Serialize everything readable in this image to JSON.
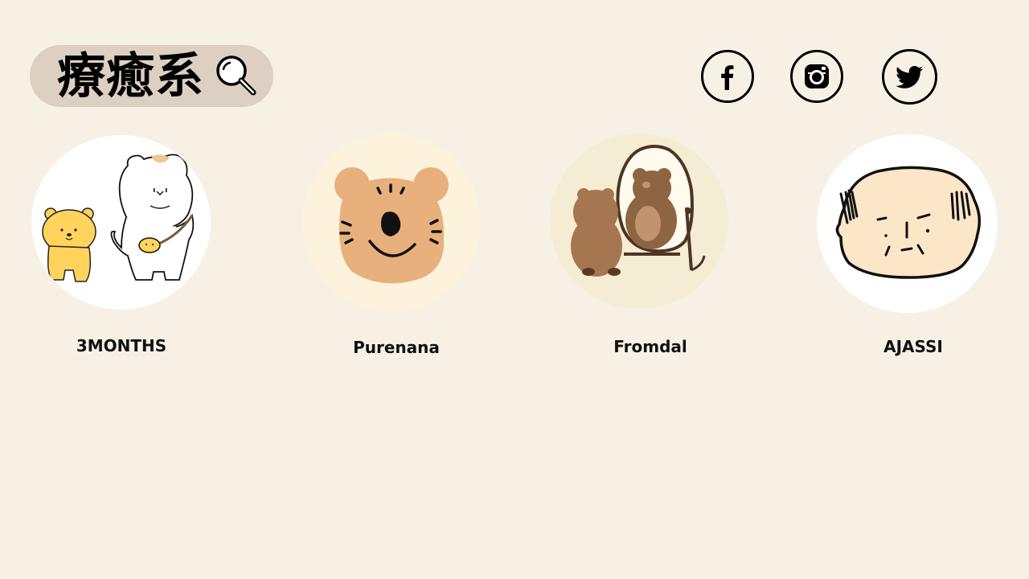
{
  "header": {
    "title": "療癒系",
    "search_icon": "search-icon"
  },
  "social": [
    {
      "name": "facebook",
      "icon": "facebook-icon"
    },
    {
      "name": "instagram",
      "icon": "instagram-icon"
    },
    {
      "name": "twitter",
      "icon": "twitter-icon"
    }
  ],
  "characters": [
    {
      "label": "3MONTHS",
      "avatar": "two-white-and-yellow-bears-avatar"
    },
    {
      "label": "Purenana",
      "avatar": "tiger-face-avatar"
    },
    {
      "label": "Fromdal",
      "avatar": "bear-mirror-avatar"
    },
    {
      "label": "AJASSI",
      "avatar": "bald-man-face-avatar"
    }
  ],
  "colors": {
    "background": "#f6f1e4",
    "pill": "#ddcfc2",
    "tiger_bg": "#fdf3dc",
    "tiger_fur": "#e8b07c",
    "bear_brown": "#a57650",
    "face_skin": "#fce6c8"
  }
}
